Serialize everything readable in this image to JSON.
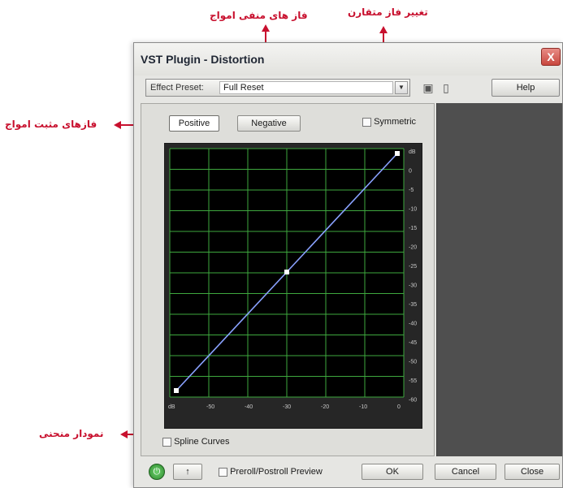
{
  "annotations": {
    "negative_phases": "فاز های منفی امواج",
    "phase_symmetry": "تغییر فاز متقارن",
    "positive_phases": "فازهای مثبت امواج",
    "curve_graph": "نمودار منحنی"
  },
  "window": {
    "title": "VST Plugin - Distortion",
    "close_label": "X"
  },
  "preset": {
    "label": "Effect Preset:",
    "value": "Full Reset",
    "dropdown_glyph": "▼",
    "save_glyph": "▣",
    "delete_glyph": "▯",
    "help_label": "Help"
  },
  "controls": {
    "positive_label": "Positive",
    "negative_label": "Negative",
    "symmetric_label": "Symmetric",
    "spline_label": "Spline Curves"
  },
  "graph": {
    "y_ticks": [
      "dB",
      "0",
      "-5",
      "-10",
      "-15",
      "-20",
      "-25",
      "-30",
      "-35",
      "-40",
      "-45",
      "-50",
      "-55",
      "-60"
    ],
    "x_ticks": [
      "dB",
      "-50",
      "-40",
      "-30",
      "-20",
      "-10",
      "0"
    ],
    "line_color": "#8aa2ff",
    "grid_color": "#3ea83e",
    "point_color": "#ffffff"
  },
  "footer": {
    "power_glyph": "⏻",
    "arrow_glyph": "↑",
    "preview_label": "Preroll/Postroll Preview",
    "ok_label": "OK",
    "cancel_label": "Cancel",
    "close_label": "Close"
  }
}
